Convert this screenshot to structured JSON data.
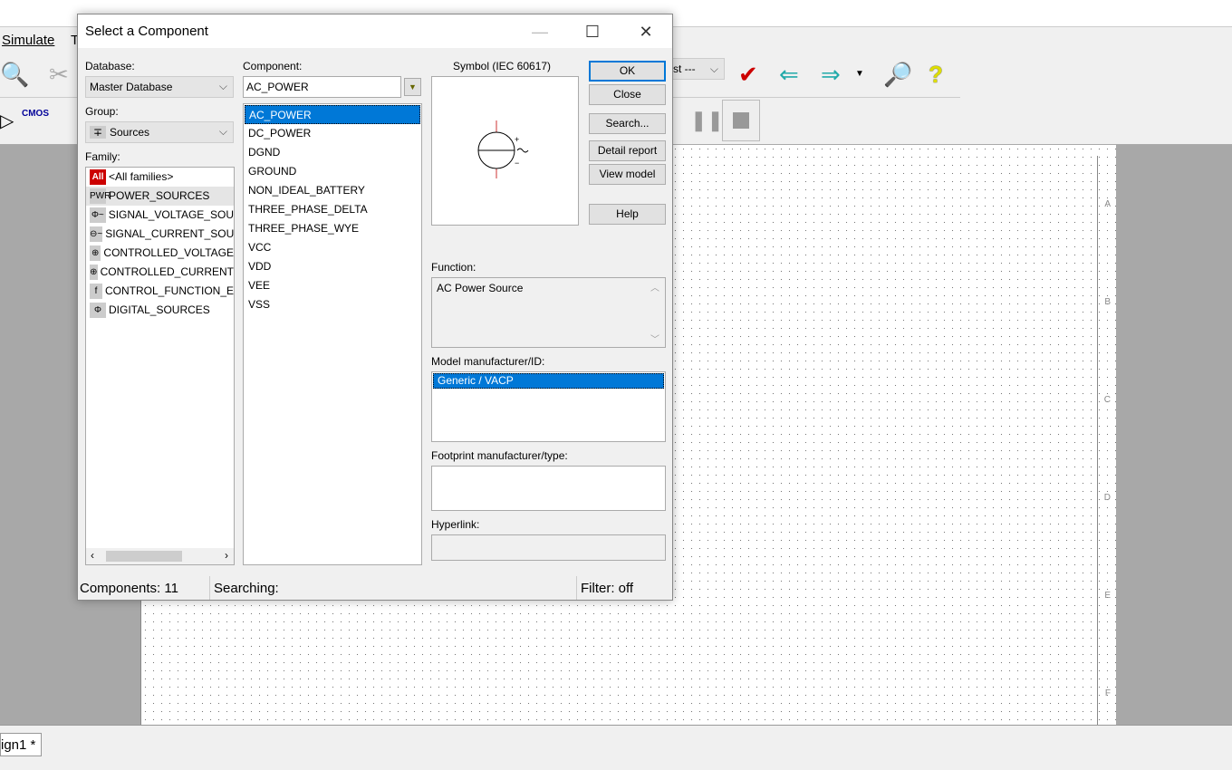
{
  "app": {
    "menu_visible": [
      "Simulate",
      "T"
    ],
    "sheet_tab": "ign1 *",
    "row_labels": [
      "A",
      "B",
      "C",
      "D",
      "E",
      "F"
    ],
    "toolbar_dropdown": "st ---"
  },
  "dialog": {
    "title": "Select a Component",
    "database_label": "Database:",
    "database_value": "Master Database",
    "group_label": "Group:",
    "group_value": "Sources",
    "family_label": "Family:",
    "families": [
      {
        "icon": "All",
        "label": "<All families>"
      },
      {
        "icon": "PWR",
        "label": "POWER_SOURCES"
      },
      {
        "icon": "Φ~",
        "label": "SIGNAL_VOLTAGE_SOU"
      },
      {
        "icon": "⊖~",
        "label": "SIGNAL_CURRENT_SOU"
      },
      {
        "icon": "⊕",
        "label": "CONTROLLED_VOLTAGE"
      },
      {
        "icon": "⊕",
        "label": "CONTROLLED_CURRENT"
      },
      {
        "icon": "f",
        "label": "CONTROL_FUNCTION_E"
      },
      {
        "icon": "Φ",
        "label": "DIGITAL_SOURCES"
      }
    ],
    "selected_family": "POWER_SOURCES",
    "component_label": "Component:",
    "component_value": "AC_POWER",
    "components": [
      "AC_POWER",
      "DC_POWER",
      "DGND",
      "GROUND",
      "NON_IDEAL_BATTERY",
      "THREE_PHASE_DELTA",
      "THREE_PHASE_WYE",
      "VCC",
      "VDD",
      "VEE",
      "VSS"
    ],
    "selected_component": "AC_POWER",
    "symbol_label": "Symbol (IEC 60617)",
    "buttons": {
      "ok": "OK",
      "close": "Close",
      "search": "Search...",
      "detail": "Detail report",
      "view_model": "View model",
      "help": "Help"
    },
    "function_label": "Function:",
    "function_value": "AC Power Source",
    "model_label": "Model manufacturer/ID:",
    "models": [
      "Generic / VACP"
    ],
    "footprint_label": "Footprint manufacturer/type:",
    "hyperlink_label": "Hyperlink:",
    "status": {
      "components": "Components: 11",
      "searching": "Searching:",
      "filter": "Filter: off"
    }
  }
}
